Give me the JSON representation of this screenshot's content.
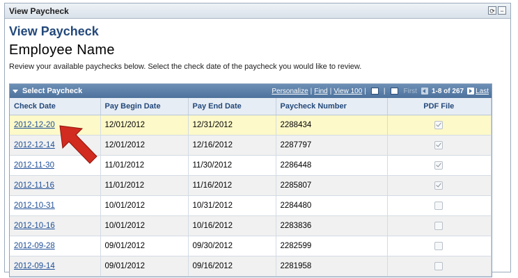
{
  "window": {
    "title": "View Paycheck",
    "controls": [
      "refresh-icon",
      "minimize-icon"
    ]
  },
  "page": {
    "heading": "View Paycheck",
    "employee_name": "Employee Name",
    "instructions": "Review your available paychecks below. Select the check date of the paycheck you would like to review."
  },
  "grid": {
    "title": "Select Paycheck",
    "links": {
      "personalize": "Personalize",
      "find": "Find",
      "view_all": "View 100"
    },
    "pager": {
      "first": "First",
      "range": "1-8 of 267",
      "last": "Last"
    },
    "columns": [
      "Check Date",
      "Pay Begin Date",
      "Pay End Date",
      "Paycheck Number",
      "PDF File"
    ],
    "rows": [
      {
        "check_date": "2012-12-20",
        "begin": "12/01/2012",
        "end": "12/31/2012",
        "number": "2288434",
        "pdf": true,
        "selected": true
      },
      {
        "check_date": "2012-12-14",
        "begin": "12/01/2012",
        "end": "12/16/2012",
        "number": "2287797",
        "pdf": true
      },
      {
        "check_date": "2012-11-30",
        "begin": "11/01/2012",
        "end": "11/30/2012",
        "number": "2286448",
        "pdf": true
      },
      {
        "check_date": "2012-11-16",
        "begin": "11/01/2012",
        "end": "11/16/2012",
        "number": "2285807",
        "pdf": true
      },
      {
        "check_date": "2012-10-31",
        "begin": "10/01/2012",
        "end": "10/31/2012",
        "number": "2284480",
        "pdf": false
      },
      {
        "check_date": "2012-10-16",
        "begin": "10/01/2012",
        "end": "10/16/2012",
        "number": "2283836",
        "pdf": false
      },
      {
        "check_date": "2012-09-28",
        "begin": "09/01/2012",
        "end": "09/30/2012",
        "number": "2282599",
        "pdf": false
      },
      {
        "check_date": "2012-09-14",
        "begin": "09/01/2012",
        "end": "09/16/2012",
        "number": "2281958",
        "pdf": false
      }
    ]
  },
  "colors": {
    "accent": "#23487a",
    "link": "#1f4f97",
    "highlight_row": "#fdf9c8",
    "pointer_arrow": "#d22b1f"
  }
}
